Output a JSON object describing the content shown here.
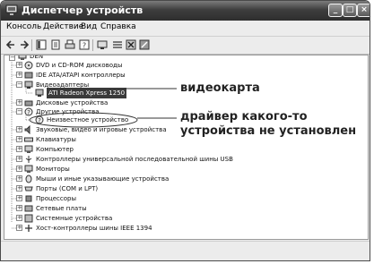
{
  "window": {
    "title": "Диспетчер устройств"
  },
  "menu": [
    "Консоль",
    "Действие",
    "Вид",
    "Справка"
  ],
  "tree": {
    "root": "DEN",
    "items": [
      "DVD и CD-ROM дисководы",
      "IDE ATA/ATAPI контроллеры",
      "Видеоадаптеры",
      "ATI Radeon Xpress 1250",
      "Дисковые устройства",
      "Другие устройства",
      "Неизвестное устройство",
      "Звуковые, видео и игровые устройства",
      "Клавиатуры",
      "Компьютер",
      "Контроллеры универсальной последовательной шины USB",
      "Мониторы",
      "Мыши и иные указывающие устройства",
      "Порты (COM и LPT)",
      "Процессоры",
      "Сетевые платы",
      "Системные устройства",
      "Хост-контроллеры шины IEEE 1394"
    ]
  },
  "annotations": {
    "video": "видеокарта",
    "driver_line1": "драйвер какого-то",
    "driver_line2": "устройства не установлен"
  }
}
